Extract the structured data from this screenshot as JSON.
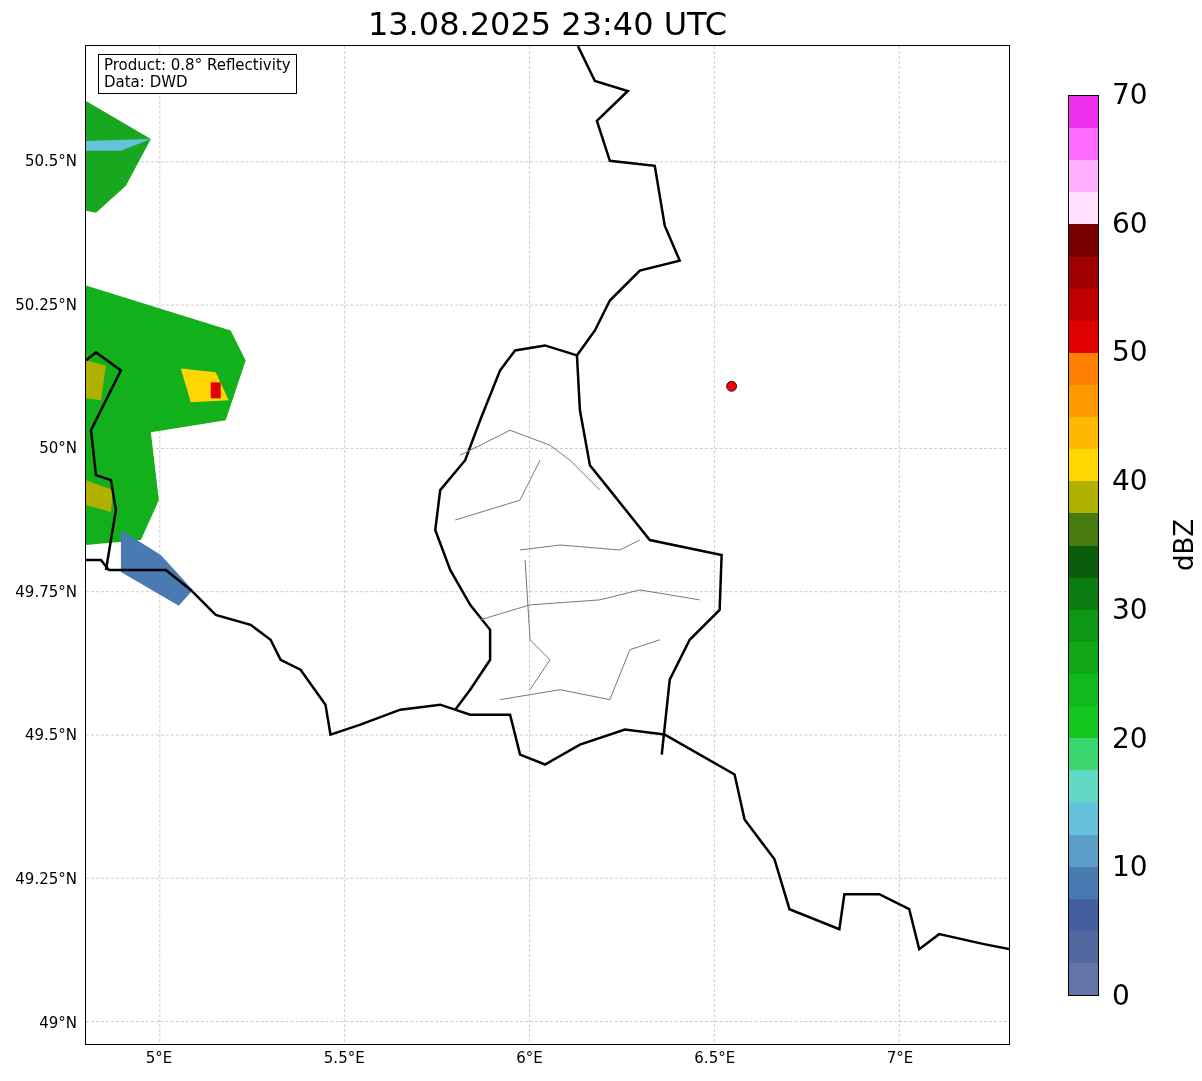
{
  "title": "13.08.2025 23:40 UTC",
  "map": {
    "info": [
      "Product: 0.8° Reflectivity",
      "Data: DWD"
    ],
    "lat_labels": [
      "50.5°N",
      "50.25°N",
      "50°N",
      "49.75°N",
      "49.5°N",
      "49.25°N",
      "49°N"
    ],
    "lon_labels": [
      "5°E",
      "5.5°E",
      "6°E",
      "6.5°E",
      "7°E"
    ]
  },
  "colorbar": {
    "label": "dBZ",
    "ticks": [
      "70",
      "60",
      "50",
      "40",
      "30",
      "20",
      "10",
      "0"
    ],
    "bins": [
      {
        "color": "#ee30ee"
      },
      {
        "color": "#ff6cff"
      },
      {
        "color": "#ffb0ff"
      },
      {
        "color": "#ffe0ff"
      },
      {
        "color": "#780000"
      },
      {
        "color": "#a00000"
      },
      {
        "color": "#c00000"
      },
      {
        "color": "#e00000"
      },
      {
        "color": "#ff7f00"
      },
      {
        "color": "#ff9900"
      },
      {
        "color": "#ffb800"
      },
      {
        "color": "#ffd700"
      },
      {
        "color": "#b0b000"
      },
      {
        "color": "#477a0f"
      },
      {
        "color": "#0b5c0b"
      },
      {
        "color": "#0c7d10"
      },
      {
        "color": "#0e9714"
      },
      {
        "color": "#10a816"
      },
      {
        "color": "#11b91a"
      },
      {
        "color": "#12c81e"
      },
      {
        "color": "#3cd670"
      },
      {
        "color": "#60d8c4"
      },
      {
        "color": "#66c1dc"
      },
      {
        "color": "#5a9ec8"
      },
      {
        "color": "#4a7ab2"
      },
      {
        "color": "#445fa0"
      },
      {
        "color": "#5468a0"
      },
      {
        "color": "#6474a8"
      }
    ]
  }
}
